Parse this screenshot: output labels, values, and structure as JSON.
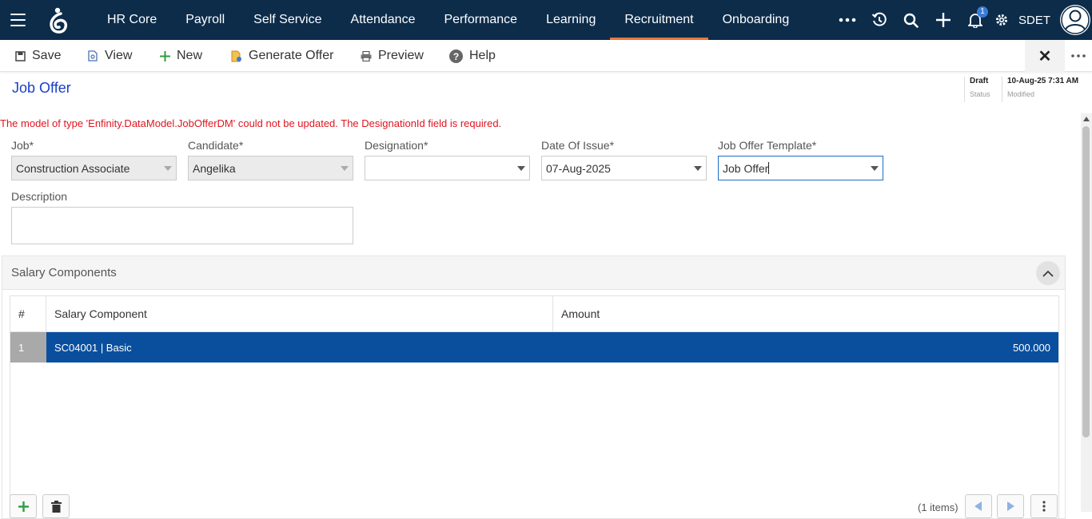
{
  "nav": {
    "items": [
      {
        "label": "HR Core"
      },
      {
        "label": "Payroll"
      },
      {
        "label": "Self Service"
      },
      {
        "label": "Attendance"
      },
      {
        "label": "Performance"
      },
      {
        "label": "Learning"
      },
      {
        "label": "Recruitment",
        "active": true
      },
      {
        "label": "Onboarding"
      }
    ],
    "notification_count": "1",
    "user_name": "SDET",
    "accent_color": "#e8763c",
    "bg_color": "#0c2c4a"
  },
  "toolbar": {
    "save_label": "Save",
    "view_label": "View",
    "new_label": "New",
    "generate_offer_label": "Generate Offer",
    "preview_label": "Preview",
    "help_label": "Help"
  },
  "page": {
    "title": "Job Offer",
    "status_value": "Draft",
    "status_label": "Status",
    "modified_value": "10-Aug-25 7:31 AM",
    "modified_label": "Modified",
    "error_message": "The model of type 'Enfinity.DataModel.JobOfferDM' could not be updated. The DesignationId field is required."
  },
  "form": {
    "job_label": "Job*",
    "job_value": "Construction Associate",
    "candidate_label": "Candidate*",
    "candidate_value": "Angelika",
    "designation_label": "Designation*",
    "designation_value": "",
    "date_label": "Date Of Issue*",
    "date_value": "07-Aug-2025",
    "template_label": "Job Offer Template*",
    "template_value": "Job Offer",
    "description_label": "Description"
  },
  "salary": {
    "title": "Salary Components",
    "columns": [
      "#",
      "Salary Component",
      "Amount"
    ],
    "rows": [
      {
        "num": "1",
        "component": "SC04001 | Basic",
        "amount": "500.000"
      }
    ],
    "items_count": "(1 items)"
  }
}
